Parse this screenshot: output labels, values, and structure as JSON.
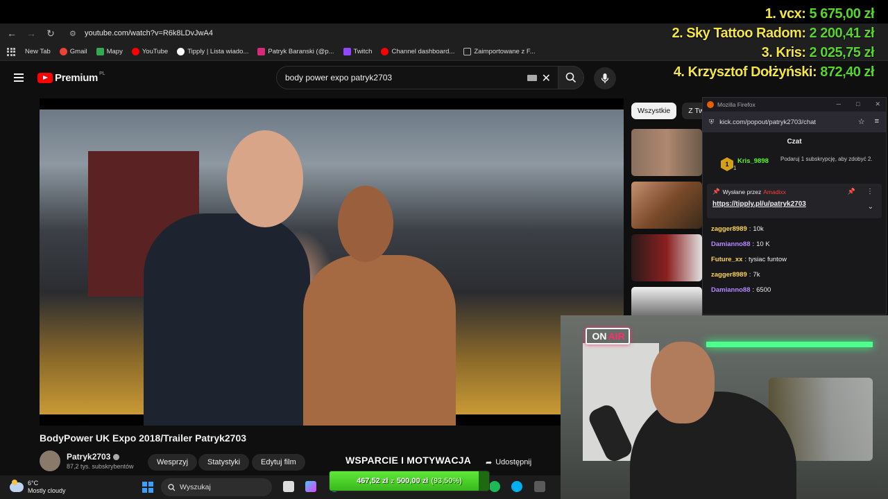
{
  "browser": {
    "url": "youtube.com/watch?v=R6k8LDvJwA4",
    "bookmarks": [
      {
        "label": "New Tab",
        "color": "#1f1f1f"
      },
      {
        "label": "Gmail",
        "color": "#ea4335"
      },
      {
        "label": "Mapy",
        "color": "#34a853"
      },
      {
        "label": "YouTube",
        "color": "#ff0000"
      },
      {
        "label": "Tipply | Lista wiado...",
        "color": "#ffffff"
      },
      {
        "label": "Patryk Baranski (@p...",
        "color": "#d62976"
      },
      {
        "label": "Twitch",
        "color": "#9146ff"
      },
      {
        "label": "Channel dashboard...",
        "color": "#ff0000"
      },
      {
        "label": "Zaimportowane z F...",
        "color": "#1f1f1f"
      }
    ]
  },
  "youtube": {
    "brand": "Premium",
    "country": "PL",
    "search_query": "body power expo patryk2703",
    "video_title": "BodyPower UK Expo 2018/Trailer Patryk2703",
    "channel_name": "Patryk2703",
    "subscribers": "87,2 tys. subskrybentów",
    "buttons": {
      "support": "Wesprzyj",
      "stats": "Statystyki",
      "edit": "Edytuj film",
      "share": "Udostępnij"
    },
    "chips": [
      "Wszystkie",
      "Z Tw"
    ]
  },
  "chat": {
    "window_title": "Mozilla Firefox",
    "url": "kick.com/popout/patryk2703/chat",
    "title": "Czat",
    "top_gifter": {
      "rank": "1",
      "user": "Kris_9898",
      "count": "1"
    },
    "gift_note": "Podaruj 1 subskrypcję, aby zdobyć 2.",
    "pinned": {
      "prefix": "Wysłane przez",
      "user": "Amadixx",
      "link": "https://tipply.pl/u/patryk2703"
    },
    "messages": [
      {
        "user": "zagger8989",
        "text": "10k",
        "color": "#ffd54f"
      },
      {
        "user": "Damianno88",
        "text": "10 K",
        "color": "#b388ff"
      },
      {
        "user": "Future_xx",
        "text": "tysiac funtow",
        "color": "#ffd54f"
      },
      {
        "user": "zagger8989",
        "text": "7k",
        "color": "#ffd54f"
      },
      {
        "user": "Damianno88",
        "text": "6500",
        "color": "#b388ff"
      }
    ]
  },
  "donors": [
    {
      "name": "1. vcx: ",
      "amount": "5 675,00 zł"
    },
    {
      "name": "2. Sky Tattoo Radom: ",
      "amount": "2 200,41 zł"
    },
    {
      "name": "3. Kris: ",
      "amount": "2 025,75 zł"
    },
    {
      "name": "4. Krzysztof Dołżyński: ",
      "amount": "872,40 zł"
    }
  ],
  "overlay": {
    "on_air_1": "ON",
    "on_air_2": "AIR",
    "goal_title": "WSPARCIE I MOTYWACJA",
    "goal_current": "467,52 zł",
    "goal_separator": "z",
    "goal_target": "500,00 zł",
    "goal_percent_label": "(93,50%)",
    "goal_fraction": 0.935
  },
  "taskbar": {
    "temperature": "6°C",
    "condition": "Mostly cloudy",
    "search": "Wyszukaj"
  }
}
